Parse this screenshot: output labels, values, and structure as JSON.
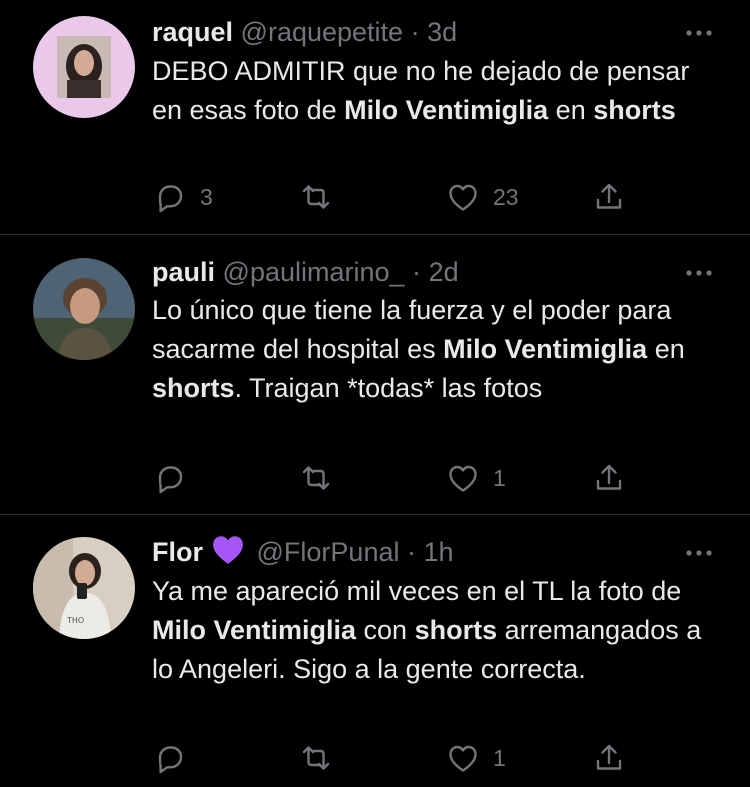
{
  "tweets": [
    {
      "name": "raquel",
      "handle": "@raquepetite",
      "dot": "·",
      "time": "3d",
      "body": [
        {
          "text": "DEBO ADMITIR que no he dejado de pensar en esas foto de ",
          "bold": false
        },
        {
          "text": "Milo Ventimiglia",
          "bold": true
        },
        {
          "text": " en ",
          "bold": false
        },
        {
          "text": "shorts",
          "bold": true
        }
      ],
      "replies": "3",
      "retweets": "",
      "likes": "23"
    },
    {
      "name": "pauli",
      "handle": "@paulimarino_",
      "dot": "·",
      "time": "2d",
      "body": [
        {
          "text": "Lo único que tiene la fuerza y el poder para sacarme del hospital es ",
          "bold": false
        },
        {
          "text": "Milo Ventimiglia",
          "bold": true
        },
        {
          "text": " en ",
          "bold": false
        },
        {
          "text": "shorts",
          "bold": true
        },
        {
          "text": ". Traigan *todas* las fotos",
          "bold": false
        }
      ],
      "replies": "",
      "retweets": "",
      "likes": "1"
    },
    {
      "name": "Flor",
      "handle": "@FlorPunal",
      "dot": "·",
      "time": "1h",
      "name_badge": "purple-heart-emoji",
      "body": [
        {
          "text": "Ya me apareció mil veces en el TL la foto de ",
          "bold": false
        },
        {
          "text": "Milo Ventimiglia",
          "bold": true
        },
        {
          "text": " con ",
          "bold": false
        },
        {
          "text": "shorts",
          "bold": true
        },
        {
          "text": " arremangados a lo Angeleri. Sigo a la gente correcta.",
          "bold": false
        }
      ],
      "replies": "",
      "retweets": "",
      "likes": "1"
    }
  ],
  "colors": {
    "background": "#000000",
    "text": "#e7e9ea",
    "secondary": "#71767b",
    "divider": "#2f3336",
    "purple_heart": "#a855f7"
  },
  "icons": [
    "reply-icon",
    "retweet-icon",
    "like-icon",
    "share-icon",
    "more-options-icon"
  ]
}
